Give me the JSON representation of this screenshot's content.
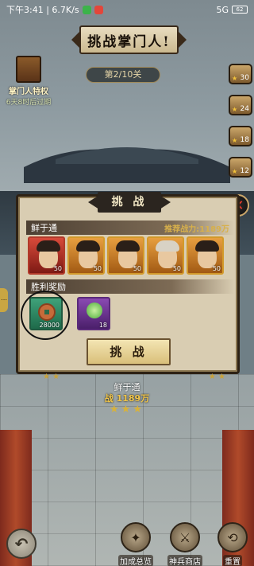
{
  "status_bar": {
    "time_speed": "下午3:41 | 6.7K/s",
    "signal": "5G",
    "battery": "62"
  },
  "header": {
    "title": "挑战掌门人!",
    "level": "第2/10关"
  },
  "privilege": {
    "label": "掌门人特权",
    "time": "6天8时后过期"
  },
  "stage_ladder": [
    "30",
    "24",
    "18",
    "12"
  ],
  "dialog": {
    "title": "挑 战",
    "opponent_name": "鲜于通",
    "power_label": "推荐战力:1189万",
    "heroes": [
      {
        "level": "50"
      },
      {
        "level": "50"
      },
      {
        "level": "50"
      },
      {
        "level": "50"
      },
      {
        "level": "50"
      }
    ],
    "reward_section": "胜利奖励",
    "rewards": [
      {
        "name": "coin",
        "qty": "28000"
      },
      {
        "name": "jade",
        "qty": "18"
      }
    ],
    "button": "挑 战"
  },
  "stand": {
    "name": "鲜于通",
    "power": "战 1189万",
    "stars": "★★★"
  },
  "bottom_bar": {
    "items": [
      {
        "label": "加成总览"
      },
      {
        "label": "神兵商店"
      },
      {
        "label": "重置"
      }
    ]
  },
  "colors": {
    "accent_gold": "#d7b04b",
    "dialog_bg": "#d9cdb2",
    "close_red": "#e23a2a"
  }
}
